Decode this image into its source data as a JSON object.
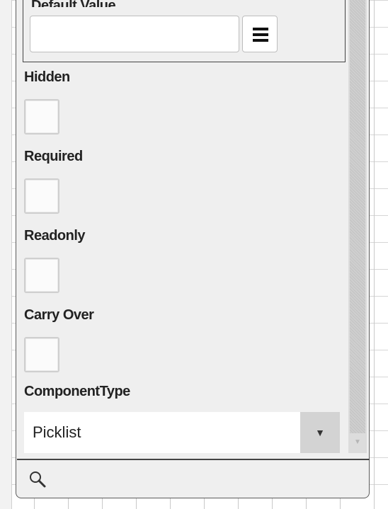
{
  "fields": {
    "default_value": {
      "label": "Default Value",
      "value": ""
    },
    "hidden": {
      "label": "Hidden",
      "checked": false
    },
    "required": {
      "label": "Required",
      "checked": false
    },
    "readonly": {
      "label": "Readonly",
      "checked": false
    },
    "carry_over": {
      "label": "Carry Over",
      "checked": false
    },
    "component_type": {
      "label": "ComponentType",
      "selected": "Picklist"
    }
  },
  "icons": {
    "menu": "hamburger-menu-icon",
    "dropdown": "triangle-down-icon",
    "search": "magnifier-icon",
    "scroll_down": "scroll-down-arrow-icon"
  }
}
